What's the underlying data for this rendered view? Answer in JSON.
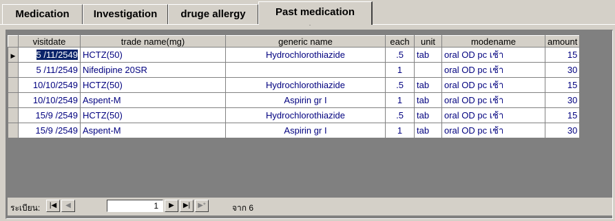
{
  "tabs": [
    {
      "label": "Medication",
      "active": false
    },
    {
      "label": "Investigation",
      "active": false
    },
    {
      "label": "druge allergy",
      "active": false
    },
    {
      "label": "Past medication",
      "active": true
    }
  ],
  "table": {
    "columns": [
      "visitdate",
      "trade name(mg)",
      "generic name",
      "each",
      "unit",
      "modename",
      "amount"
    ],
    "rows": [
      {
        "visitdate": "5 /11/2549",
        "trade": "HCTZ(50)",
        "generic": "Hydrochlorothiazide",
        "each": ".5",
        "unit": "tab",
        "mode": "oral OD pc เช้า",
        "amount": "15"
      },
      {
        "visitdate": "5 /11/2549",
        "trade": "Nifedipine 20SR",
        "generic": "",
        "each": "1",
        "unit": "",
        "mode": "oral OD pc เช้า",
        "amount": "30"
      },
      {
        "visitdate": "10/10/2549",
        "trade": "HCTZ(50)",
        "generic": "Hydrochlorothiazide",
        "each": ".5",
        "unit": "tab",
        "mode": "oral OD pc เช้า",
        "amount": "15"
      },
      {
        "visitdate": "10/10/2549",
        "trade": "Aspent-M",
        "generic": "Aspirin gr I",
        "each": "1",
        "unit": "tab",
        "mode": "oral OD pc เช้า",
        "amount": "30"
      },
      {
        "visitdate": "15/9 /2549",
        "trade": "HCTZ(50)",
        "generic": "Hydrochlorothiazide",
        "each": ".5",
        "unit": "tab",
        "mode": "oral OD pc เช้า",
        "amount": "15"
      },
      {
        "visitdate": "15/9 /2549",
        "trade": "Aspent-M",
        "generic": "Aspirin gr I",
        "each": "1",
        "unit": "tab",
        "mode": "oral OD pc เช้า",
        "amount": "30"
      }
    ]
  },
  "navigator": {
    "label": "ระเบียน:",
    "current": "1",
    "total_text": "จาก 6",
    "first": "|◀",
    "prev": "◀",
    "next": "▶",
    "last": "▶|",
    "new": "▶*"
  },
  "icons": {
    "row_selector": "current-record-arrow-icon",
    "cursor": "mouse-pointer-icon"
  },
  "colors": {
    "cell_text": "#00007f",
    "selection": "#0a246a",
    "chrome": "#d4d0c8"
  }
}
